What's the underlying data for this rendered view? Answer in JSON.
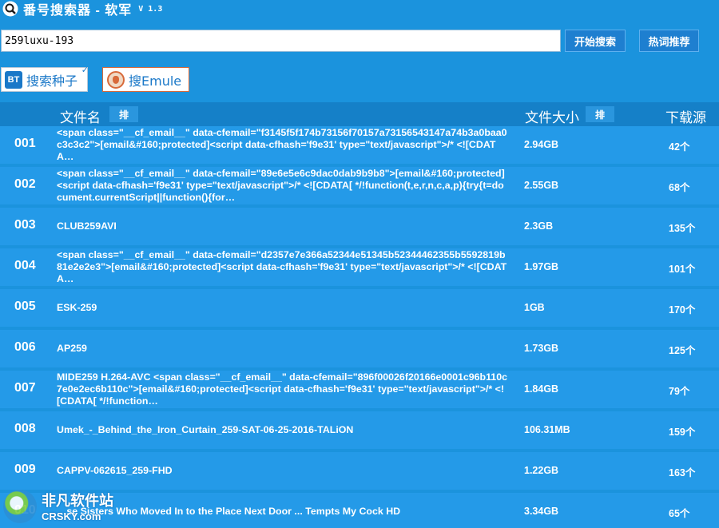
{
  "window": {
    "title": "番号搜索器 - 软军",
    "version": "V 1.3"
  },
  "search": {
    "value": "259luxu-193",
    "start_label": "开始搜索",
    "hot_label": "热词推荐"
  },
  "sources": {
    "bt_badge": "BT",
    "bt_label": "搜索种子",
    "emule_label": "搜Emule"
  },
  "header": {
    "name": "文件名",
    "size": "文件大小",
    "source": "下载源",
    "sort": "排"
  },
  "rows": [
    {
      "num": "001",
      "name": "<span class=\"__cf_email__\" data-cfemail=\"f3145f5f174b73156f70157a73156543147a74b3a0baa0c3c3c2\">[email&#160;protected]<script data-cfhash='f9e31' type=\"text/javascript\">/* <![CDATA…",
      "size": "2.94GB",
      "count": "42个"
    },
    {
      "num": "002",
      "name": "<span class=\"__cf_email__\" data-cfemail=\"89e6e5e6c9dac0dab9b9b8\">[email&#160;protected]<script data-cfhash='f9e31' type=\"text/javascript\">/* <![CDATA[ */!function(t,e,r,n,c,a,p){try{t=document.currentScript||function(){for…",
      "size": "2.55GB",
      "count": "68个"
    },
    {
      "num": "003",
      "name": "CLUB259AVI",
      "size": "2.3GB",
      "count": "135个"
    },
    {
      "num": "004",
      "name": "<span class=\"__cf_email__\" data-cfemail=\"d2357e7e366a52344e51345b52344462355b5592819b81e2e2e3\">[email&#160;protected]<script data-cfhash='f9e31' type=\"text/javascript\">/* <![CDATA…",
      "size": "1.97GB",
      "count": "101个"
    },
    {
      "num": "005",
      "name": "ESK-259",
      "size": "1GB",
      "count": "170个"
    },
    {
      "num": "006",
      "name": "AP259",
      "size": "1.73GB",
      "count": "125个"
    },
    {
      "num": "007",
      "name": "MIDE259 H.264-AVC <span class=\"__cf_email__\" data-cfemail=\"896f00026f20166e0001c96b110c7e0e2ec6b110c\">[email&#160;protected]<script data-cfhash='f9e31' type=\"text/javascript\">/* <![CDATA[ */!function…",
      "size": "1.84GB",
      "count": "79个"
    },
    {
      "num": "008",
      "name": "Umek_-_Behind_the_Iron_Curtain_259-SAT-06-25-2016-TALiON",
      "size": "106.31MB",
      "count": "159个"
    },
    {
      "num": "009",
      "name": "CAPPV-062615_259-FHD",
      "size": "1.22GB",
      "count": "163个"
    },
    {
      "num": "010",
      "name": "…se Sisters Who Moved In to the Place Next Door ... Tempts My Cock HD",
      "size": "3.34GB",
      "count": "65个"
    }
  ],
  "watermark": {
    "cn": "非凡软件站",
    "en": "CRSKY.com"
  },
  "colors": {
    "background": "#1b93dd",
    "row": "#249ae8",
    "header": "#1580c8"
  }
}
